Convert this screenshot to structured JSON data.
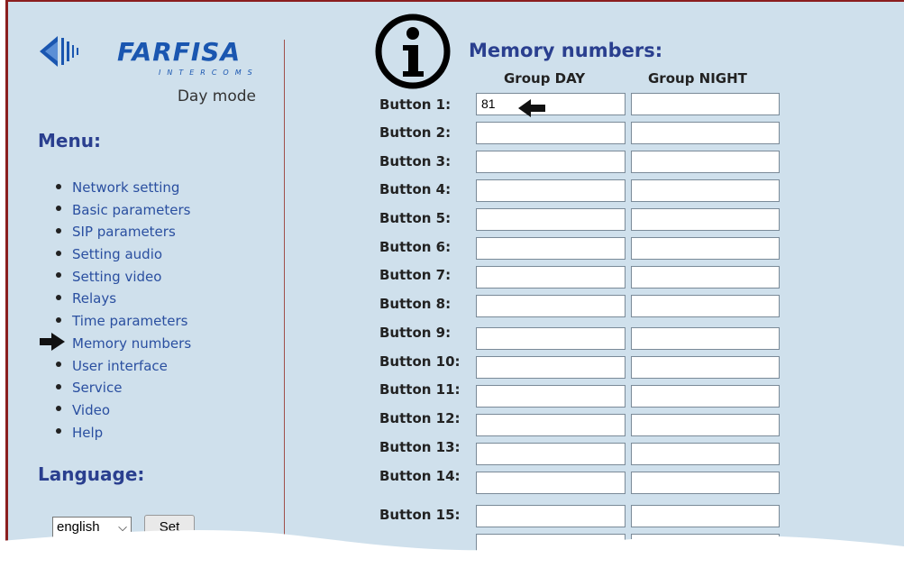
{
  "brand": {
    "name": "FARFISA",
    "tagline": "INTERCOMS"
  },
  "mode_label": "Day mode",
  "menu": {
    "title": "Menu:",
    "items": [
      {
        "label": "Network setting"
      },
      {
        "label": "Basic parameters"
      },
      {
        "label": "SIP parameters"
      },
      {
        "label": "Setting audio"
      },
      {
        "label": "Setting video"
      },
      {
        "label": "Relays"
      },
      {
        "label": "Time parameters"
      },
      {
        "label": "Memory numbers"
      },
      {
        "label": "User interface"
      },
      {
        "label": "Service"
      },
      {
        "label": "Video"
      },
      {
        "label": "Help"
      }
    ],
    "active_index": 7
  },
  "language": {
    "title": "Language:",
    "selected": "english",
    "set_label": "Set"
  },
  "main": {
    "title": "Memory numbers:",
    "col_day": "Group DAY",
    "col_night": "Group NIGHT",
    "rows": [
      {
        "label": "Button 1:",
        "day": "81",
        "night": ""
      },
      {
        "label": "Button 2:",
        "day": "",
        "night": ""
      },
      {
        "label": "Button 3:",
        "day": "",
        "night": ""
      },
      {
        "label": "Button 4:",
        "day": "",
        "night": ""
      },
      {
        "label": "Button 5:",
        "day": "",
        "night": ""
      },
      {
        "label": "Button 6:",
        "day": "",
        "night": ""
      },
      {
        "label": "Button 7:",
        "day": "",
        "night": ""
      },
      {
        "label": "Button 8:",
        "day": "",
        "night": ""
      },
      {
        "label": "Button 9:",
        "day": "",
        "night": ""
      },
      {
        "label": "Button 10:",
        "day": "",
        "night": ""
      },
      {
        "label": "Button 11:",
        "day": "",
        "night": ""
      },
      {
        "label": "Button 12:",
        "day": "",
        "night": ""
      },
      {
        "label": "Button 13:",
        "day": "",
        "night": ""
      },
      {
        "label": "Button 14:",
        "day": "",
        "night": ""
      },
      {
        "label": "Button 15:",
        "day": "",
        "night": ""
      }
    ]
  },
  "icons": {
    "info": "info-icon",
    "menu_pointer": "arrow-right-icon",
    "input_pointer": "arrow-left-icon"
  },
  "colors": {
    "background": "#cfe0ec",
    "frame_border": "#8b1e1e",
    "heading": "#2a3f8f",
    "link": "#2a4fa0",
    "brand": "#1a56b0"
  }
}
